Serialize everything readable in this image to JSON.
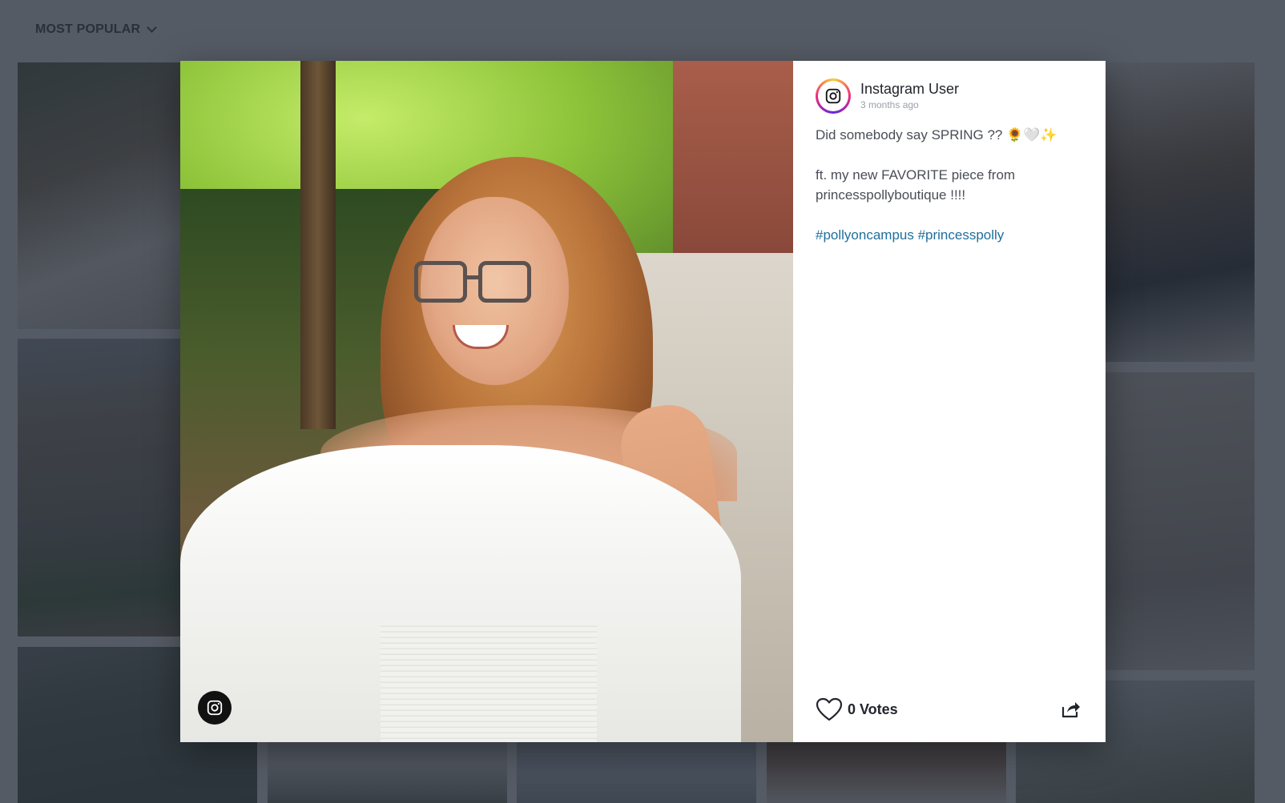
{
  "header": {
    "sort_label": "MOST POPULAR"
  },
  "modal": {
    "user": {
      "name": "Instagram User",
      "time": "3 months ago",
      "avatar_icon": "instagram-icon"
    },
    "caption": {
      "line1": "Did somebody say SPRING ?? 🌻🤍✨",
      "line2": "ft. my new FAVORITE piece from princesspollyboutique !!!!",
      "tags": "#pollyoncampus #princesspolly"
    },
    "votes_label": "0 Votes",
    "icons": {
      "heart": "heart-icon",
      "share": "share-icon",
      "badge": "instagram-icon"
    }
  },
  "colors": {
    "hashtag": "#1f6f9c",
    "overlay": "#28303c",
    "panel_bg": "#ffffff"
  }
}
